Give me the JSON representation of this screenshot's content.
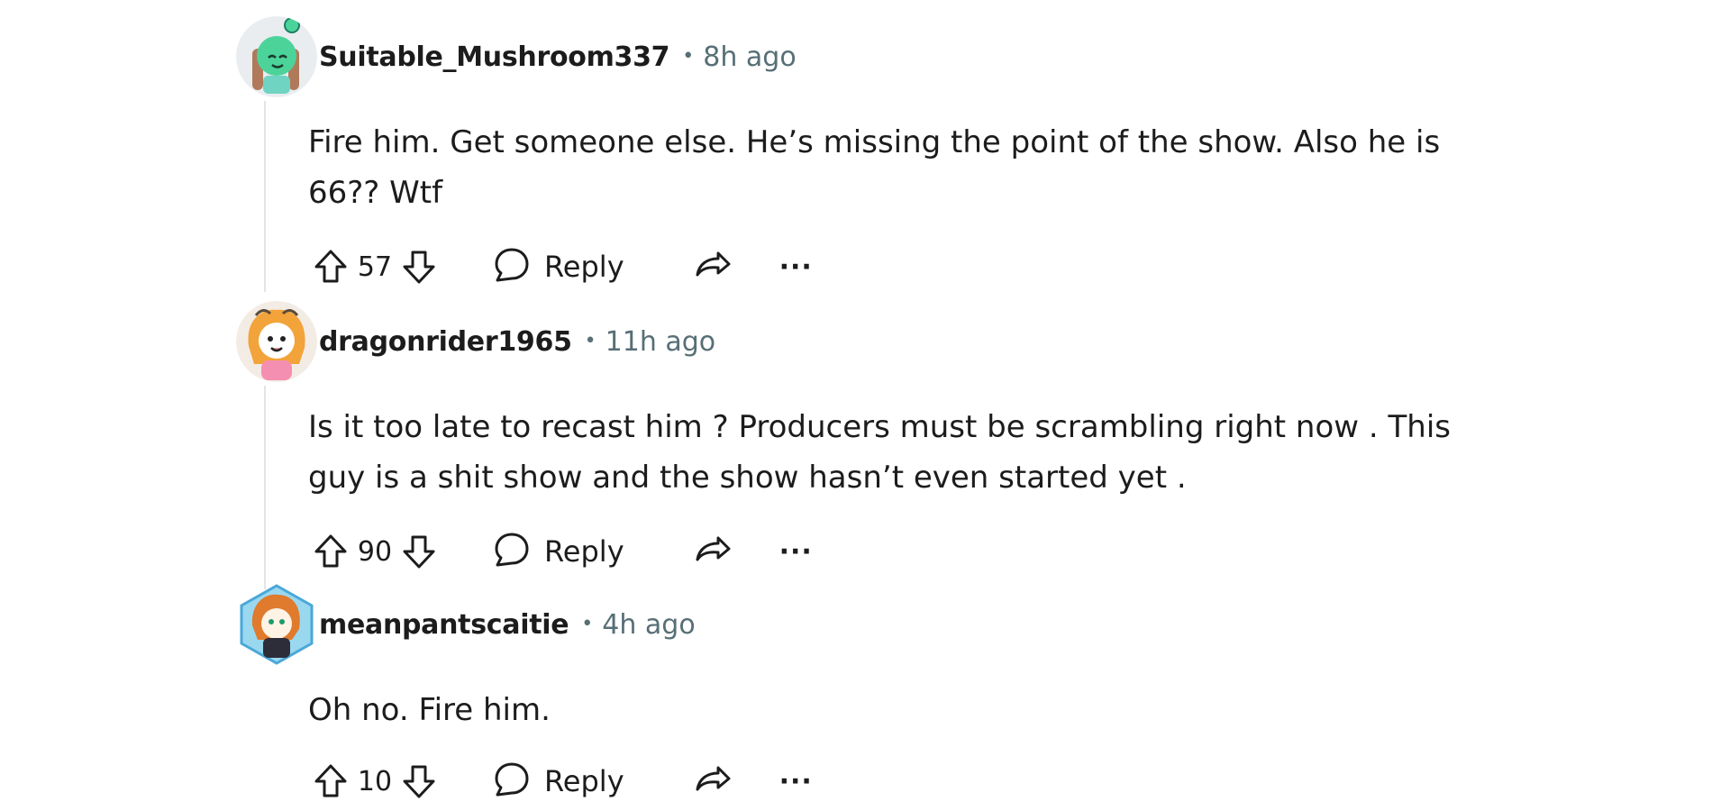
{
  "comments": [
    {
      "username": "Suitable_Mushroom337",
      "separator": "•",
      "time": "8h ago",
      "body": "Fire him. Get someone else. He’s missing the point of the show. Also he is\n66?? Wtf",
      "votes": "57",
      "reply_label": "Reply",
      "more_label": "···",
      "avatar_icon": "green-snoo-avatar"
    },
    {
      "username": "dragonrider1965",
      "separator": "•",
      "time": "11h ago",
      "body": "Is it too late to recast him ? Producers must be scrambling right now . This\nguy is a shit show and the show hasn’t even started yet .",
      "votes": "90",
      "reply_label": "Reply",
      "more_label": "···",
      "avatar_icon": "orange-hair-snoo-avatar"
    },
    {
      "username": "meanpantscaitie",
      "separator": "•",
      "time": "4h ago",
      "body": "Oh no. Fire him.",
      "votes": "10",
      "reply_label": "Reply",
      "more_label": "···",
      "avatar_icon": "nft-snoo-avatar"
    }
  ],
  "icons": {
    "upvote": "upvote-arrow-icon",
    "downvote": "downvote-arrow-icon",
    "reply": "speech-bubble-icon",
    "share": "share-arrow-icon",
    "more": "ellipsis-icon"
  },
  "colors": {
    "text": "#1c1c1c",
    "meta": "#576f76",
    "thread_line": "#e2e5e7"
  }
}
